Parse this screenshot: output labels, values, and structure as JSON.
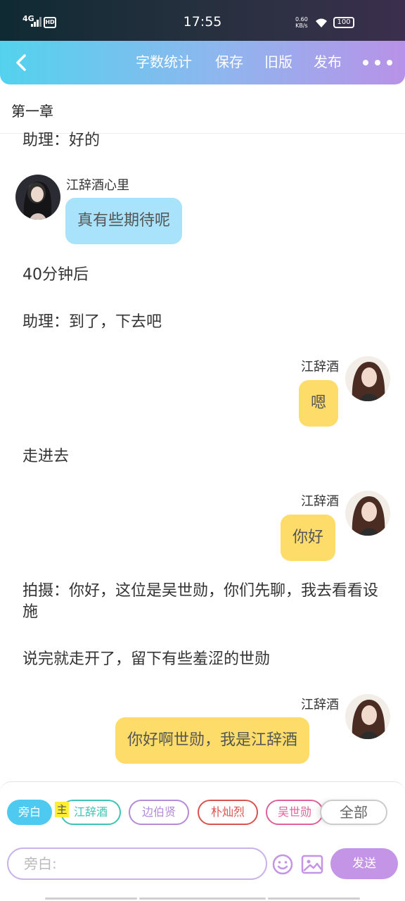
{
  "status_bar": {
    "network": "4G",
    "hd": "HD",
    "time": "17:55",
    "speed_value": "0.60",
    "speed_unit": "KB/s",
    "battery": "100"
  },
  "toolbar": {
    "word_count": "字数统计",
    "save": "保存",
    "old_version": "旧版",
    "publish": "发布"
  },
  "chapter_title": "第一章",
  "messages": {
    "m1": "助理：好的",
    "m2_speaker": "江辞酒心里",
    "m2_text": "真有些期待呢",
    "m3": "40分钟后",
    "m4": "助理：到了，下去吧",
    "m5_speaker": "江辞酒",
    "m5_text": "嗯",
    "m6": "走进去",
    "m7_speaker": "江辞酒",
    "m7_text": "你好",
    "m8": "拍摄：你好，这位是吴世勋，你们先聊，我去看看设施",
    "m9": "说完就走开了，留下有些羞涩的世勋",
    "m10_speaker": "江辞酒",
    "m10_text": "你好啊世勋，我是江辞酒"
  },
  "characters": [
    {
      "label": "旁白",
      "color": "#4ec9f0"
    },
    {
      "label": "江辞酒",
      "color": "#3fc3b6"
    },
    {
      "label": "边伯贤",
      "color": "#b58ad6"
    },
    {
      "label": "朴灿烈",
      "color": "#d9534f"
    },
    {
      "label": "吴世勋",
      "color": "#e0609a"
    },
    {
      "label": "全部",
      "color": "#cccccc"
    }
  ],
  "main_badge": "主",
  "input": {
    "placeholder": "旁白:"
  },
  "send_label": "发送"
}
